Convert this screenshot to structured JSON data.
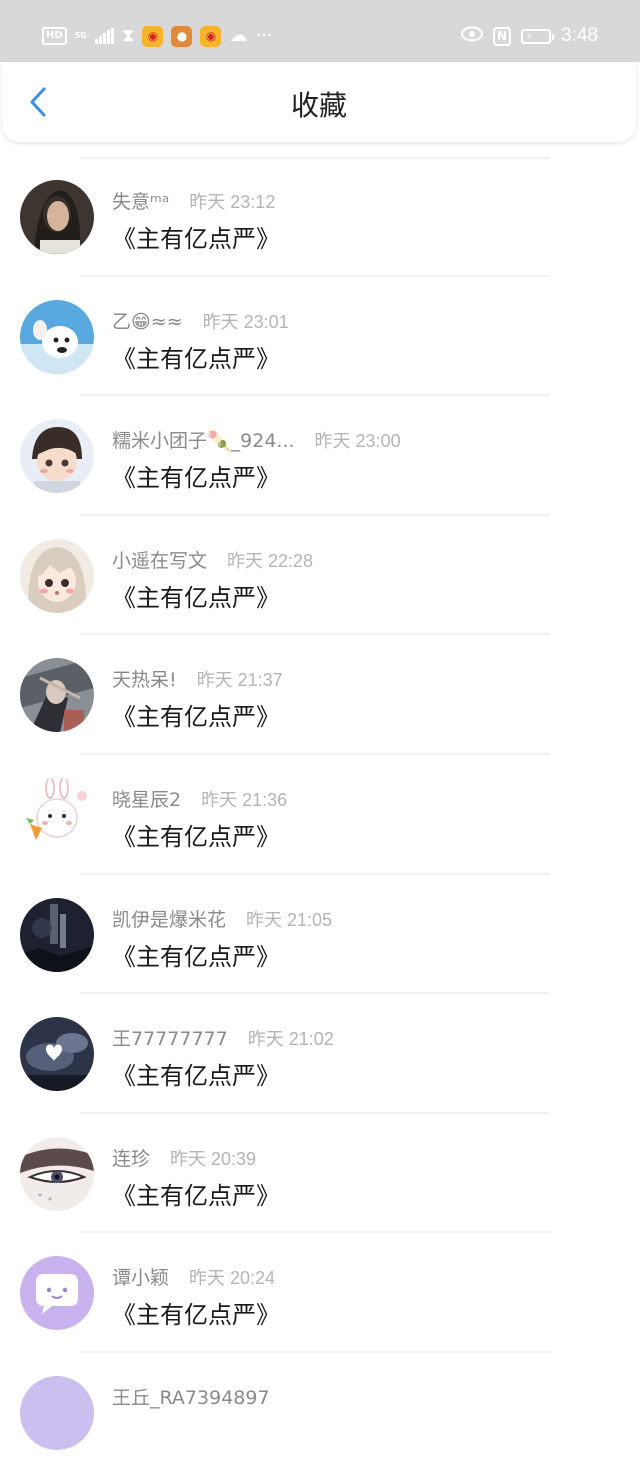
{
  "status_bar": {
    "badge": "HD",
    "network": "5G",
    "time": "3:48",
    "nfc": "N"
  },
  "nav": {
    "title": "收藏",
    "back_icon": "chevron-left-icon",
    "accent": "#3a8ee6"
  },
  "list": [
    {
      "name": "失意ᵐᵃ",
      "time": "昨天 23:12",
      "message": "《主有亿点严》"
    },
    {
      "name": "乙😁≈≈",
      "time": "昨天 23:01",
      "message": "《主有亿点严》"
    },
    {
      "name": "糯米小团子🍡_924...",
      "time": "昨天 23:00",
      "message": "《主有亿点严》"
    },
    {
      "name": "小遥在写文",
      "time": "昨天 22:28",
      "message": "《主有亿点严》"
    },
    {
      "name": "天热呆!",
      "time": "昨天 21:37",
      "message": "《主有亿点严》"
    },
    {
      "name": "晓星辰2",
      "time": "昨天 21:36",
      "message": "《主有亿点严》"
    },
    {
      "name": "凯伊是爆米花",
      "time": "昨天 21:05",
      "message": "《主有亿点严》"
    },
    {
      "name": "王77777777",
      "time": "昨天 21:02",
      "message": "《主有亿点严》"
    },
    {
      "name": "连珍",
      "time": "昨天 20:39",
      "message": "《主有亿点严》"
    },
    {
      "name": "谭小颖",
      "time": "昨天 20:24",
      "message": "《主有亿点严》"
    },
    {
      "name": "王丘_RA7394897",
      "time": "",
      "message": ""
    }
  ]
}
